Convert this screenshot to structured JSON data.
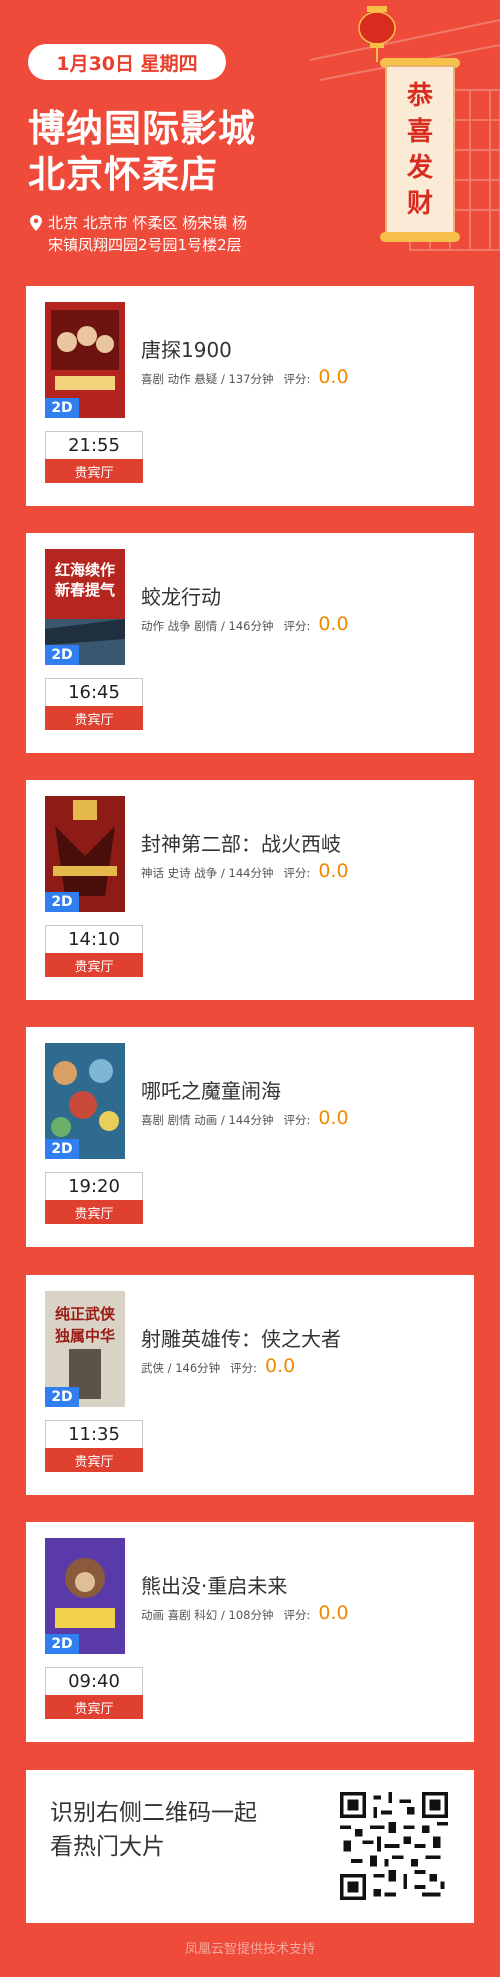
{
  "header": {
    "date_label": "1月30日 星期四",
    "cinema_line1": "博纳国际影城",
    "cinema_line2": "北京怀柔店",
    "address_line1": "北京 北京市 怀柔区 杨宋镇 杨",
    "address_line2": "宋镇凤翔四园2号园1号楼2层",
    "scroll_text": "恭喜发财",
    "icons": [
      "location-pin-icon",
      "lantern-icon",
      "temple-roof-icon",
      "scroll-icon"
    ]
  },
  "movies": [
    {
      "title": "唐探1900",
      "genres": "喜剧 动作 悬疑",
      "duration": "137分钟",
      "score_label": "评分:",
      "score": "0.0",
      "format": "2D",
      "time": "21:55",
      "hall": "贵宾厅",
      "poster_color": "#b3241f"
    },
    {
      "title": "蛟龙行动",
      "genres": "动作 战争 剧情",
      "duration": "146分钟",
      "score_label": "评分:",
      "score": "0.0",
      "format": "2D",
      "time": "16:45",
      "hall": "贵宾厅",
      "poster_color": "#b52620",
      "poster_text": [
        "红海续作",
        "新春提气"
      ]
    },
    {
      "title": "封神第二部：战火西岐",
      "genres": "神话 史诗 战争",
      "duration": "144分钟",
      "score_label": "评分:",
      "score": "0.0",
      "format": "2D",
      "time": "14:10",
      "hall": "贵宾厅",
      "poster_color": "#8e1c16"
    },
    {
      "title": "哪吒之魔童闹海",
      "genres": "喜剧 剧情 动画",
      "duration": "144分钟",
      "score_label": "评分:",
      "score": "0.0",
      "format": "2D",
      "time": "19:20",
      "hall": "贵宾厅",
      "poster_color": "#2f6a8f"
    },
    {
      "title": "射雕英雄传：侠之大者",
      "genres": "武侠",
      "duration": "146分钟",
      "score_label": "评分:",
      "score": "0.0",
      "format": "2D",
      "time": "11:35",
      "hall": "贵宾厅",
      "poster_color": "#d9d3c6",
      "poster_text": [
        "纯正武侠",
        "独属中华"
      ]
    },
    {
      "title": "熊出没·重启未来",
      "genres": "动画 喜剧 科幻",
      "duration": "108分钟",
      "score_label": "评分:",
      "score": "0.0",
      "format": "2D",
      "time": "09:40",
      "hall": "贵宾厅",
      "poster_color": "#5a3aa8"
    }
  ],
  "qr": {
    "line1": "识别右侧二维码一起",
    "line2": "看热门大片"
  },
  "footer": {
    "text": "凤凰云智提供技术支持"
  },
  "colors": {
    "background": "#ee4b3b",
    "score": "#f08a00",
    "badge_2d": "#2f7ff0",
    "hall": "#e04030"
  }
}
